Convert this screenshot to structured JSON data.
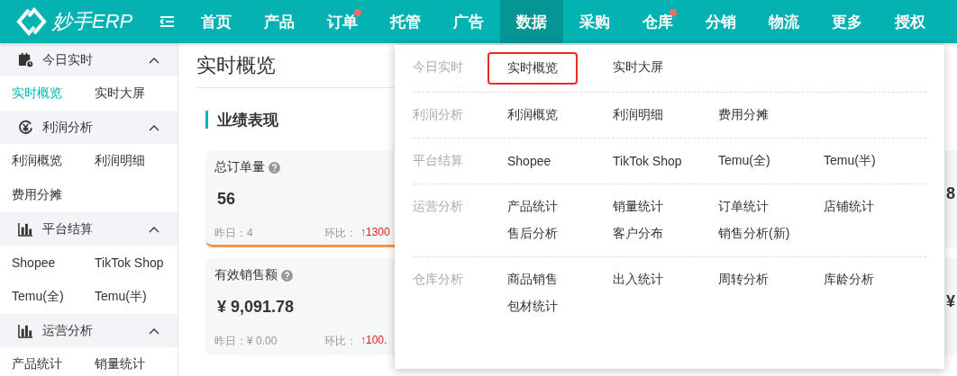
{
  "header": {
    "brand": "妙手ERP",
    "nav": [
      {
        "label": "首页",
        "selected": false,
        "dot": false
      },
      {
        "label": "产品",
        "selected": false,
        "dot": false
      },
      {
        "label": "订单",
        "selected": false,
        "dot": true
      },
      {
        "label": "托管",
        "selected": false,
        "dot": false
      },
      {
        "label": "广告",
        "selected": false,
        "dot": false
      },
      {
        "label": "数据",
        "selected": true,
        "dot": false
      },
      {
        "label": "采购",
        "selected": false,
        "dot": false
      },
      {
        "label": "仓库",
        "selected": false,
        "dot": true
      },
      {
        "label": "分销",
        "selected": false,
        "dot": false
      },
      {
        "label": "物流",
        "selected": false,
        "dot": false
      },
      {
        "label": "更多",
        "selected": false,
        "dot": false
      },
      {
        "label": "授权",
        "selected": false,
        "dot": false
      }
    ]
  },
  "sidebar": {
    "sections": [
      {
        "title": "今日实时",
        "kind": "calendar",
        "expanded": true,
        "items": [
          {
            "label": "实时概览",
            "selected": true
          },
          {
            "label": "实时大屏",
            "selected": false
          }
        ]
      },
      {
        "title": "利润分析",
        "kind": "yen",
        "expanded": true,
        "items": [
          {
            "label": "利润概览",
            "selected": false
          },
          {
            "label": "利润明细",
            "selected": false
          },
          {
            "label": "费用分摊",
            "selected": false
          }
        ]
      },
      {
        "title": "平台结算",
        "kind": "bars",
        "expanded": true,
        "items": [
          {
            "label": "Shopee",
            "selected": false
          },
          {
            "label": "TikTok Shop",
            "selected": false
          },
          {
            "label": "Temu(全)",
            "selected": false
          },
          {
            "label": "Temu(半)",
            "selected": false
          }
        ]
      },
      {
        "title": "运营分析",
        "kind": "bars",
        "expanded": true,
        "items": [
          {
            "label": "产品统计",
            "selected": false
          },
          {
            "label": "销量统计",
            "selected": false
          }
        ]
      }
    ]
  },
  "page": {
    "title": "实时概览",
    "section_title": "业绩表现",
    "cards": [
      {
        "title": "总订单量",
        "value": "56",
        "yesterday": "昨日：4",
        "ratio_label": "环比：",
        "ratio": "↑1300",
        "underline": true
      },
      {
        "title": "有效销售额",
        "value": "¥ 9,091.78",
        "yesterday": "昨日：¥ 0.00",
        "ratio_label": "环比：",
        "ratio": "↑100.",
        "underline": false
      }
    ],
    "cards_right": [
      {
        "value": "8"
      },
      {
        "value": "¥"
      }
    ]
  },
  "dropdown": {
    "groups": [
      {
        "label": "今日实时",
        "items": [
          {
            "label": "实时概览",
            "outlined": true
          },
          {
            "label": "实时大屏",
            "outlined": false
          }
        ]
      },
      {
        "label": "利润分析",
        "items": [
          {
            "label": "利润概览",
            "outlined": false
          },
          {
            "label": "利润明细",
            "outlined": false
          },
          {
            "label": "费用分摊",
            "outlined": false
          }
        ]
      },
      {
        "label": "平台结算",
        "items": [
          {
            "label": "Shopee",
            "outlined": false
          },
          {
            "label": "TikTok Shop",
            "outlined": false
          },
          {
            "label": "Temu(全)",
            "outlined": false
          },
          {
            "label": "Temu(半)",
            "outlined": false
          }
        ]
      },
      {
        "label": "运营分析",
        "items": [
          {
            "label": "产品统计",
            "outlined": false
          },
          {
            "label": "销量统计",
            "outlined": false
          },
          {
            "label": "订单统计",
            "outlined": false
          },
          {
            "label": "店铺统计",
            "outlined": false
          },
          {
            "label": "售后分析",
            "outlined": false
          },
          {
            "label": "客户分布",
            "outlined": false
          },
          {
            "label": "销售分析(新)",
            "outlined": false
          }
        ]
      },
      {
        "label": "仓库分析",
        "items": [
          {
            "label": "商品销售",
            "outlined": false
          },
          {
            "label": "出入统计",
            "outlined": false
          },
          {
            "label": "周转分析",
            "outlined": false
          },
          {
            "label": "库龄分析",
            "outlined": false
          },
          {
            "label": "包材统计",
            "outlined": false
          }
        ]
      }
    ]
  }
}
